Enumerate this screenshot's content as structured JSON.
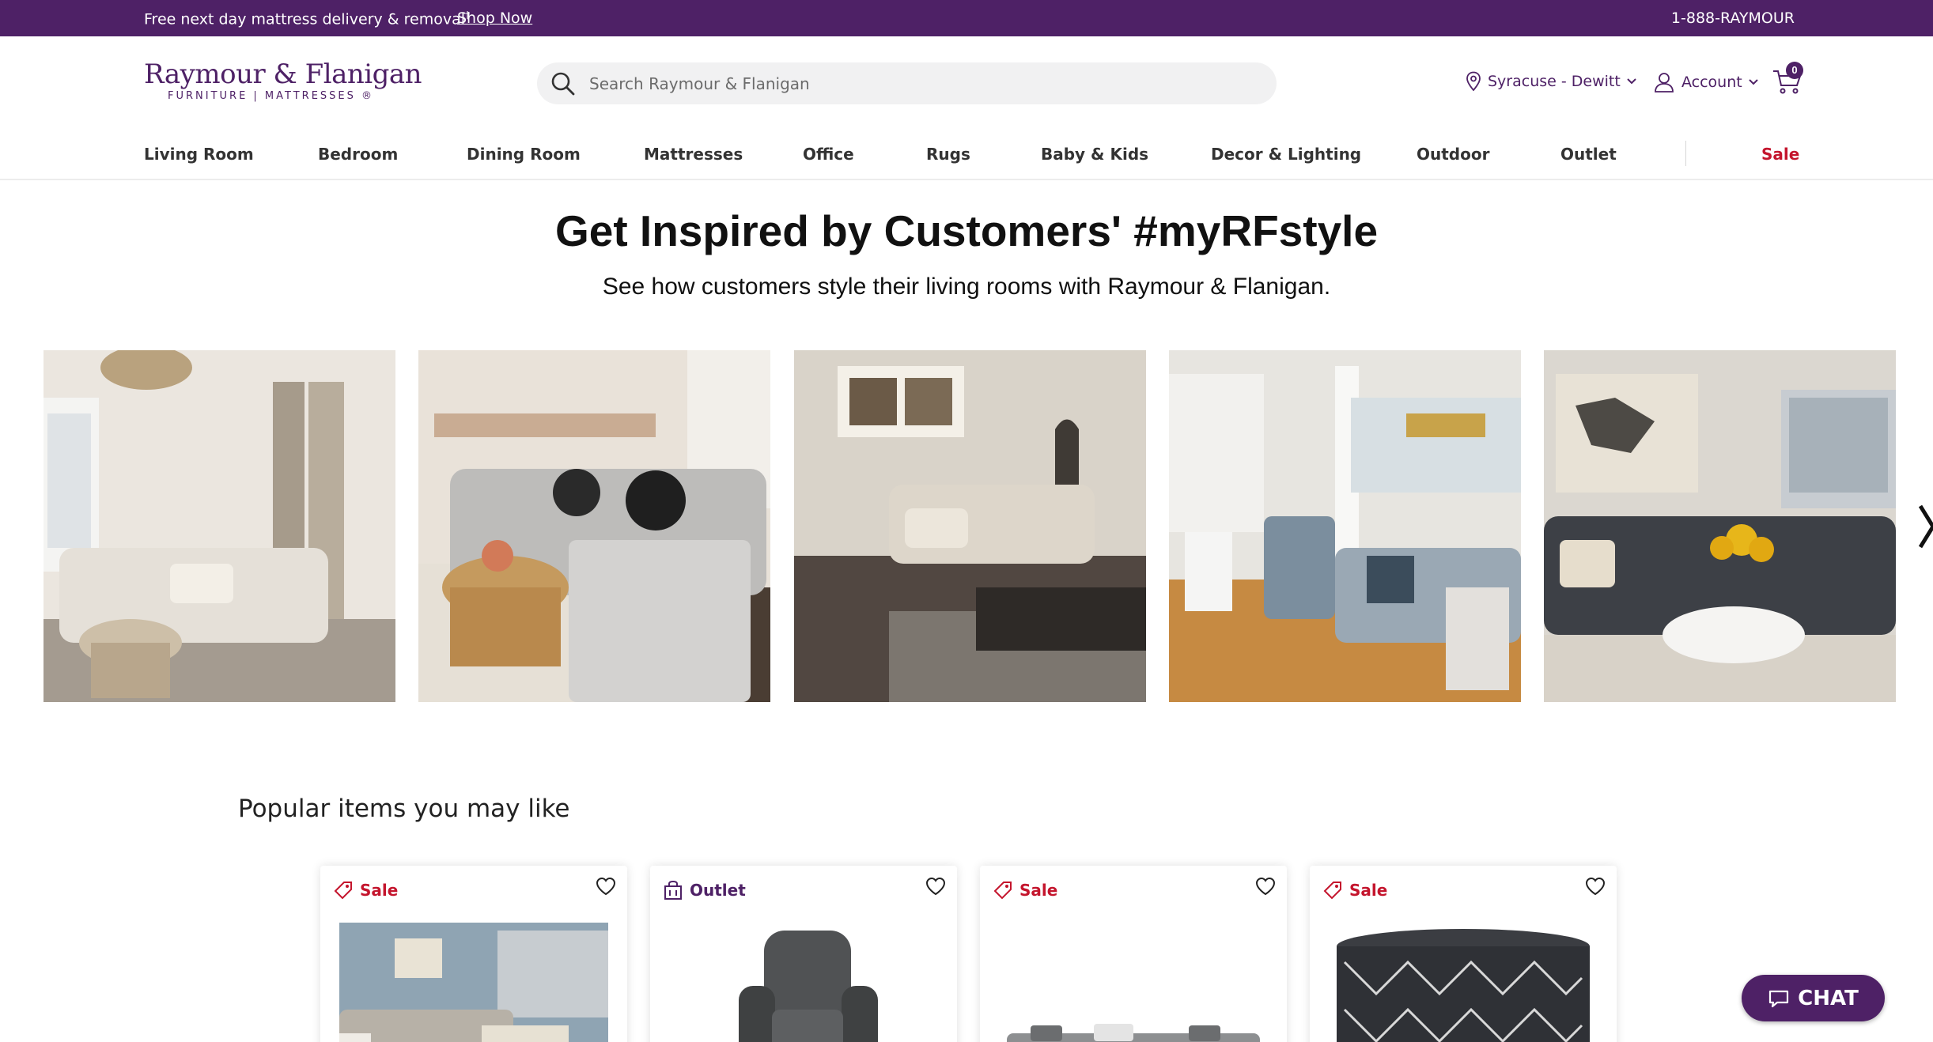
{
  "promo": {
    "text": "Free next day mattress delivery & removal",
    "mark": "†",
    "link": "Shop Now",
    "phone": "1-888-RAYMOUR"
  },
  "logo": {
    "main": "Raymour & Flanigan",
    "sub": "FURNITURE | MATTRESSES ®"
  },
  "search": {
    "placeholder": "Search Raymour & Flanigan",
    "value": ""
  },
  "header": {
    "location": "Syracuse - Dewitt",
    "account": "Account",
    "cart_count": "0"
  },
  "nav": {
    "items": [
      "Living Room",
      "Bedroom",
      "Dining Room",
      "Mattresses",
      "Office",
      "Rugs",
      "Baby & Kids",
      "Decor & Lighting",
      "Outdoor",
      "Outlet"
    ],
    "sale": "Sale"
  },
  "hero": {
    "title": "Get Inspired by Customers' #myRFstyle",
    "subtitle": "See how customers style their living rooms with Raymour & Flanigan."
  },
  "popular": {
    "title": "Popular items you may like",
    "cards": [
      {
        "tag": "Sale",
        "type": "sale"
      },
      {
        "tag": "Outlet",
        "type": "outlet"
      },
      {
        "tag": "Sale",
        "type": "sale"
      },
      {
        "tag": "Sale",
        "type": "sale"
      }
    ]
  },
  "chat": {
    "label": "CHAT"
  },
  "colors": {
    "brand": "#4e2166",
    "sale": "#c4152d"
  }
}
